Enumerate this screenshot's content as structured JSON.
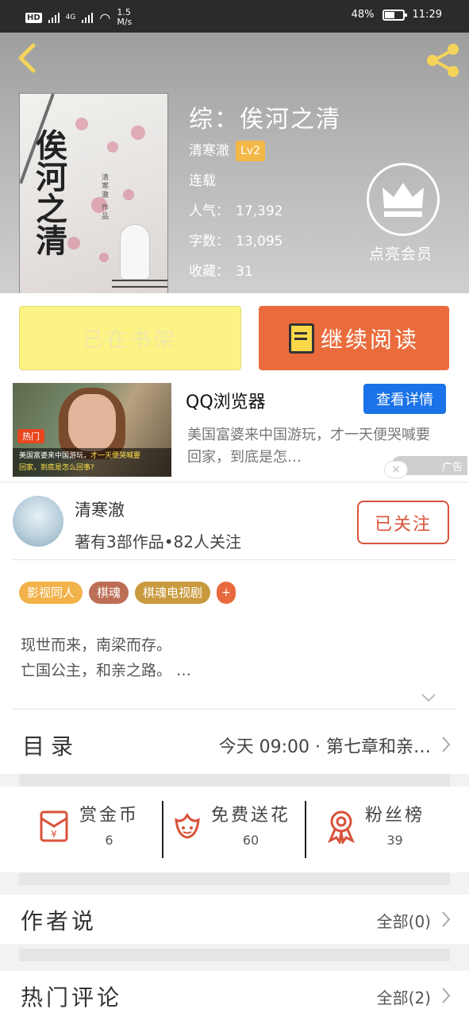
{
  "status_bar": {
    "network": "HD",
    "net_type": "4G",
    "speed": "1.5",
    "speed_unit": "M/s",
    "battery": "48%",
    "time": "11:29"
  },
  "book": {
    "title": "综：俟河之清",
    "author": "清寒澈",
    "level": "Lv2",
    "status": "连载",
    "stats": [
      {
        "label": "人气：",
        "value": "17,392"
      },
      {
        "label": "字数：",
        "value": "13,095"
      },
      {
        "label": "收藏：",
        "value": "31"
      }
    ],
    "cover_title": "俟河之清",
    "cover_author": "清寒澈 作品"
  },
  "vip": {
    "label": "点亮会员"
  },
  "actions": {
    "shelf_label": "已在书架",
    "read_label": "继续阅读"
  },
  "ad": {
    "title": "QQ浏览器",
    "button": "查看详情",
    "desc": "美国富婆来中国游玩，才一天便哭喊要回家，到底是怎…",
    "hot_tag": "热门",
    "image_caption_1": "美国富婆来中国游玩，",
    "image_caption_1b": "才一天便哭喊要",
    "image_caption_2": "回家，到底是怎么回事?",
    "label": "广告",
    "close": "×"
  },
  "author_card": {
    "name": "清寒澈",
    "meta": "著有3部作品•82人关注",
    "follow": "已关注"
  },
  "tags": [
    {
      "label": "影视同人",
      "color": "#f2b24a"
    },
    {
      "label": "棋魂",
      "color": "#bd6e56"
    },
    {
      "label": "棋魂电视剧",
      "color": "#c99a3e"
    }
  ],
  "tag_more": "+",
  "synopsis": [
    "现世而来，南梁而存。",
    "亡国公主，和亲之路。 …"
  ],
  "toc": {
    "label": "目录",
    "latest": "今天 09:00 · 第七章和亲…"
  },
  "rewards": [
    {
      "label": "赏金币",
      "count": "6",
      "icon": "red-envelope-icon"
    },
    {
      "label": "免费送花",
      "count": "60",
      "icon": "flower-icon"
    },
    {
      "label": "粉丝榜",
      "count": "39",
      "icon": "medal-icon"
    }
  ],
  "author_say": {
    "title": "作者说",
    "more": "全部(0)"
  },
  "hot_comments": {
    "title": "热门评论",
    "more": "全部(2)"
  },
  "colors": {
    "accent": "#ea6c3d",
    "follow": "#d9533a",
    "ad_button": "#1a73e8"
  }
}
